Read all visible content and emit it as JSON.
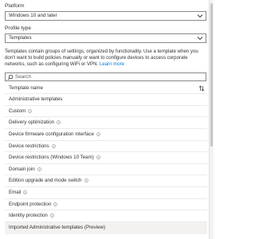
{
  "platform": {
    "label": "Platform",
    "value": "Windows 10 and later"
  },
  "profile_type": {
    "label": "Profile type",
    "value": "Templates"
  },
  "description": {
    "text": "Templates contain groups of settings, organized by functionality. Use a template when you don't want to build policies manually or want to configure devices to access corporate networks, such as configuring WiFi or VPN.",
    "link": "Learn more"
  },
  "search": {
    "placeholder": "Search"
  },
  "table": {
    "column_header": "Template name",
    "rows": [
      {
        "name": "Administrative templates",
        "info": false
      },
      {
        "name": "Custom",
        "info": true
      },
      {
        "name": "Delivery optimization",
        "info": true
      },
      {
        "name": "Device firmware configuration interface",
        "info": true
      },
      {
        "name": "Device restrictions",
        "info": true
      },
      {
        "name": "Device restrictions (Windows 10 Team)",
        "info": true
      },
      {
        "name": "Domain join",
        "info": true
      },
      {
        "name": "Edition upgrade and mode switch",
        "info": true
      },
      {
        "name": "Email",
        "info": true
      },
      {
        "name": "Endpoint protection",
        "info": true
      },
      {
        "name": "Identity protection",
        "info": true
      },
      {
        "name": "Imported Administrative templates (Preview)",
        "info": false
      }
    ]
  },
  "colors": {
    "accent": "#0078d4",
    "border": "#8a8886",
    "row_divider": "#edebe9",
    "selected_row": "#f3f2f1"
  },
  "icons": {
    "dropdown": "chevron-down-icon",
    "search": "search-icon",
    "sort": "sort-icon",
    "info": "info-icon"
  }
}
